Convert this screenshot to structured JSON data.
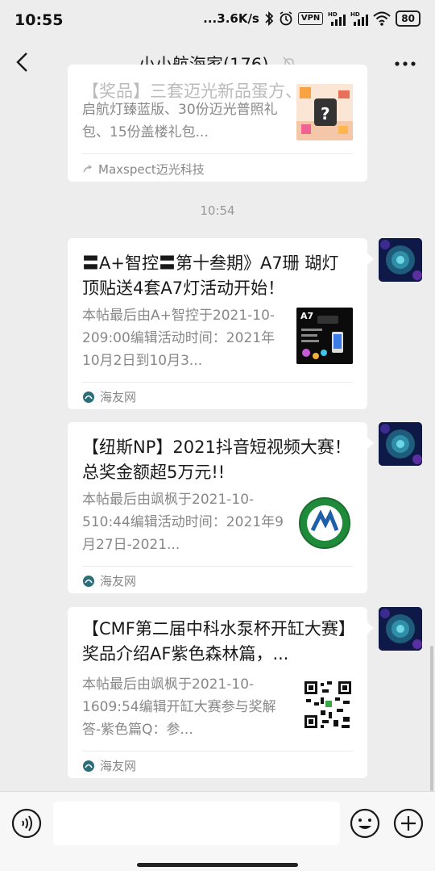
{
  "status_bar": {
    "time": "10:55",
    "network_speed": "...3.6K/s",
    "vpn": "VPN",
    "battery": "80",
    "icons": [
      "bluetooth-icon",
      "alarm-icon",
      "signal-hd-icon",
      "signal-hd-icon",
      "wifi-icon"
    ]
  },
  "header": {
    "title": "小小航海家(176)",
    "mute_icon": "bell-mute-icon",
    "back_icon": "chevron-left-icon",
    "more_icon": "more-dots-icon"
  },
  "messages": [
    {
      "title": "【奖品】三套迈光新品蛋方、",
      "desc": "启航灯臻蓝版、30份迈光普照礼包、15份盖楼礼包...",
      "source": "Maxspect迈光科技",
      "source_icon": "miniprogram-icon"
    },
    {
      "title": "〓A+智控〓第十叁期》A7珊 瑚灯顶贴送4套A7灯活动开始！",
      "desc": "本帖最后由A+智控于2021-10-209:00编辑活动时间：2021年10月2日到10月3...",
      "thumb_label": "A7",
      "source": "海友网",
      "source_icon": "haiyou-logo-icon"
    },
    {
      "title": "【纽斯NP】2021抖音短视频大赛！总奖金额超5万元!!",
      "desc": "本帖最后由飒枫于2021-10-510:44编辑活动时间：2021年9月27日-2021...",
      "source": "海友网",
      "source_icon": "haiyou-logo-icon"
    },
    {
      "title": "【CMF第二届中科水泵杯开缸大赛】奖品介绍AF紫色森林篇，...",
      "desc": "本帖最后由飒枫于2021-10-1609:54编辑开缸大赛参与奖解答-紫色篇Q：参...",
      "source": "海友网",
      "source_icon": "haiyou-logo-icon"
    }
  ],
  "timestamp": "10:54",
  "input_bar": {
    "voice_icon": "voice-icon",
    "emoji_icon": "emoji-icon",
    "plus_icon": "plus-icon"
  }
}
